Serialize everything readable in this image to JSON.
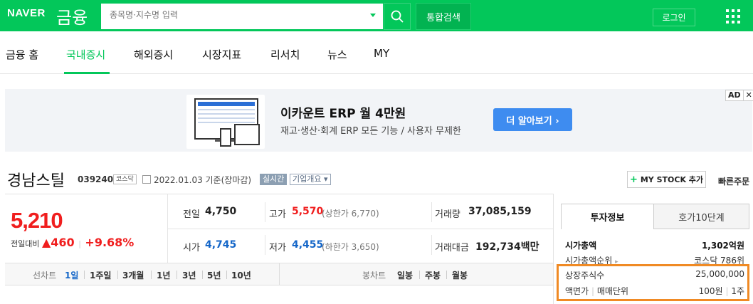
{
  "header": {
    "logo": "NAVER",
    "section": "금융",
    "search_placeholder": "종목명·지수명 입력",
    "total_search": "통합검색",
    "login": "로그인"
  },
  "nav": {
    "items": [
      "금융 홈",
      "국내증시",
      "해외증시",
      "시장지표",
      "리서치",
      "뉴스",
      "MY"
    ],
    "active": "국내증시"
  },
  "ad": {
    "title": "이카운트 ERP 월 4만원",
    "subtitle": "재고·생산·회계 ERP 모든 기능 / 사용자 무제한",
    "button": "더 알아보기 ›",
    "tag": "AD",
    "close": "✕"
  },
  "stock": {
    "name": "경남스틸",
    "code": "039240",
    "market": "코스닥",
    "date": "2022.01.03 기준(장마감)",
    "realtime": "실시간",
    "overview": "기업개요 ▾",
    "mystock": "MY STOCK 추가",
    "quick_order": "빠른주문",
    "price": "5,210",
    "change_label": "전일대비",
    "change_value": "▲460",
    "change_divider": "|",
    "change_rate": "+9.68%"
  },
  "quotes": {
    "prev_label": "전일",
    "prev": "4,750",
    "high_label": "고가",
    "high": "5,570",
    "upper_limit": "(상한가 6,770)",
    "volume_label": "거래량",
    "volume": "37,085,159",
    "open_label": "시가",
    "open": "4,745",
    "low_label": "저가",
    "low": "4,455",
    "lower_limit": "(하한가 3,650)",
    "amount_label": "거래대금",
    "amount": "192,734백만"
  },
  "period": {
    "line_label": "선차트",
    "line_items": [
      "1일",
      "1주일",
      "3개월",
      "1년",
      "3년",
      "5년",
      "10년"
    ],
    "candle_label": "봉차트",
    "candle_items": [
      "일봉",
      "주봉",
      "월봉"
    ]
  },
  "invest": {
    "tab1": "투자정보",
    "tab2": "호가10단계",
    "market_cap_label": "시가총액",
    "market_cap": "1,302억원",
    "rank_label": "시가총액순위",
    "rank_arrow": "▸",
    "rank": "코스닥 786위",
    "shares_label": "상장주식수",
    "shares": "25,000,000",
    "par_label": "액면가",
    "unit_label": "매매단위",
    "par": "100원",
    "unit": "1주",
    "divider": "|"
  },
  "colors": {
    "brand": "#03c75a",
    "up": "#f01e1e",
    "down": "#1466c8",
    "highlight": "#f08a24"
  }
}
